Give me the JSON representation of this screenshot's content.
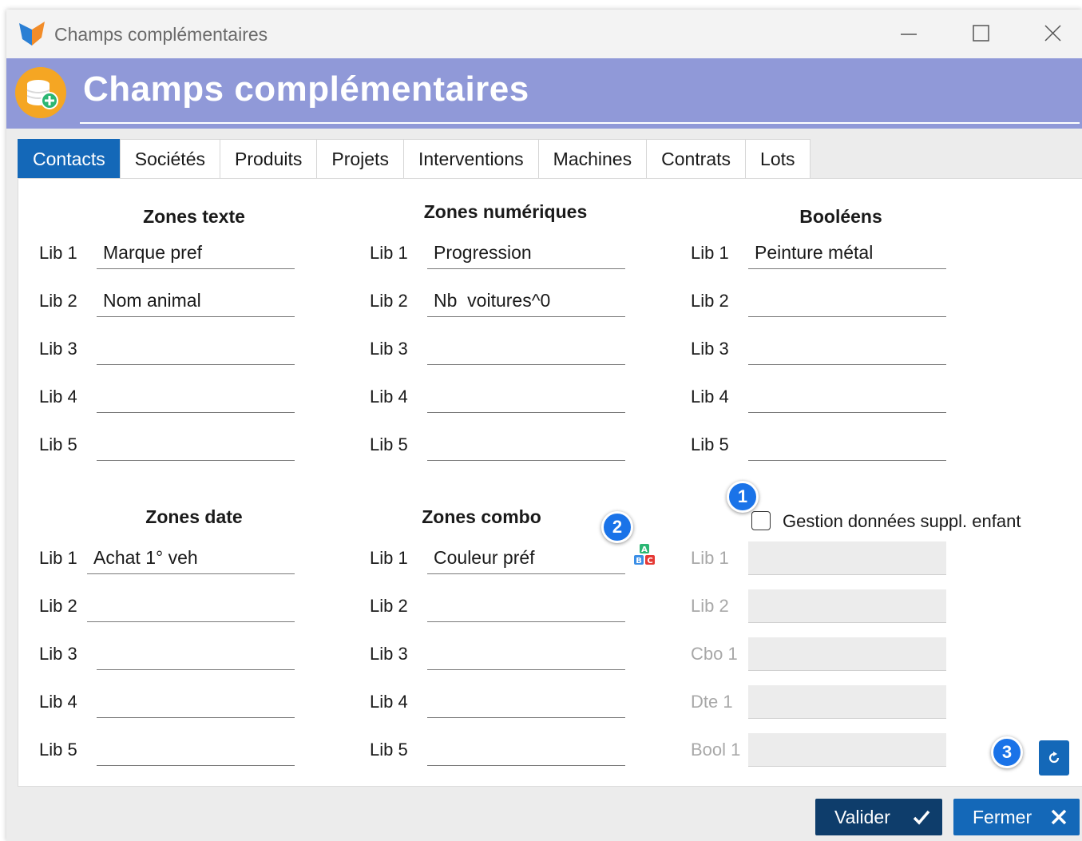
{
  "window": {
    "title": "Champs complémentaires",
    "controls": {
      "minimize": "minimize-icon",
      "maximize": "maximize-icon",
      "close": "close-icon"
    }
  },
  "header": {
    "title": "Champs complémentaires",
    "icon": "database-add-icon"
  },
  "tabs": [
    {
      "label": "Contacts",
      "active": true
    },
    {
      "label": "Sociétés"
    },
    {
      "label": "Produits"
    },
    {
      "label": "Projets"
    },
    {
      "label": "Interventions"
    },
    {
      "label": "Machines"
    },
    {
      "label": "Contrats"
    },
    {
      "label": "Lots"
    }
  ],
  "sections": {
    "text": {
      "title": "Zones texte",
      "rows": [
        {
          "label": "Lib 1",
          "value": "Marque pref"
        },
        {
          "label": "Lib 2",
          "value": "Nom animal"
        },
        {
          "label": "Lib 3",
          "value": ""
        },
        {
          "label": "Lib 4",
          "value": ""
        },
        {
          "label": "Lib 5",
          "value": ""
        }
      ]
    },
    "numeric": {
      "title": "Zones numériques",
      "rows": [
        {
          "label": "Lib 1",
          "value": "Progression"
        },
        {
          "label": "Lib 2",
          "value": "Nb  voitures^0"
        },
        {
          "label": "Lib 3",
          "value": ""
        },
        {
          "label": "Lib 4",
          "value": ""
        },
        {
          "label": "Lib 5",
          "value": ""
        }
      ]
    },
    "bool": {
      "title": "Booléens",
      "rows": [
        {
          "label": "Lib 1",
          "value": "Peinture métal"
        },
        {
          "label": "Lib 2",
          "value": ""
        },
        {
          "label": "Lib 3",
          "value": ""
        },
        {
          "label": "Lib 4",
          "value": ""
        },
        {
          "label": "Lib 5",
          "value": ""
        }
      ]
    },
    "date": {
      "title": "Zones date",
      "rows": [
        {
          "label": "Lib 1",
          "value": "Achat 1° veh"
        },
        {
          "label": "Lib 2",
          "value": ""
        },
        {
          "label": "Lib 3",
          "value": ""
        },
        {
          "label": "Lib 4",
          "value": ""
        },
        {
          "label": "Lib 5",
          "value": ""
        }
      ]
    },
    "combo": {
      "title": "Zones combo",
      "rows": [
        {
          "label": "Lib 1",
          "value": "Couleur préf"
        },
        {
          "label": "Lib 2",
          "value": ""
        },
        {
          "label": "Lib 3",
          "value": ""
        },
        {
          "label": "Lib 4",
          "value": ""
        },
        {
          "label": "Lib 5",
          "value": ""
        }
      ]
    },
    "child": {
      "checkbox_label": "Gestion données suppl. enfant",
      "checked": false,
      "rows": [
        {
          "label": "Lib 1",
          "value": ""
        },
        {
          "label": "Lib 2",
          "value": ""
        },
        {
          "label": "Cbo 1",
          "value": ""
        },
        {
          "label": "Dte 1",
          "value": ""
        },
        {
          "label": "Bool 1",
          "value": ""
        }
      ]
    }
  },
  "badges": {
    "b1": "1",
    "b2": "2",
    "b3": "3"
  },
  "footer": {
    "validate_label": "Valider",
    "close_label": "Fermer"
  },
  "colors": {
    "accent": "#1468b8",
    "banner": "#9099d8",
    "badge": "#1a73e8",
    "dark_button": "#0e3d6b"
  }
}
